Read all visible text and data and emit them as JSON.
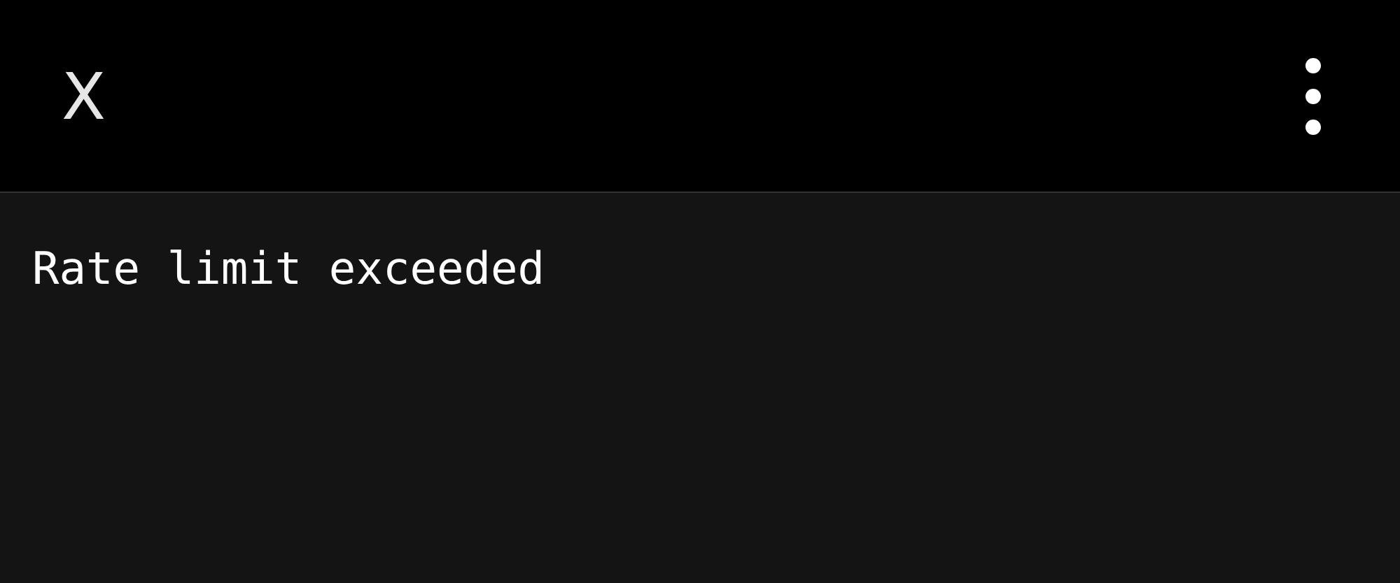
{
  "app_bar": {
    "title": "X"
  },
  "content": {
    "message": "Rate limit exceeded"
  }
}
